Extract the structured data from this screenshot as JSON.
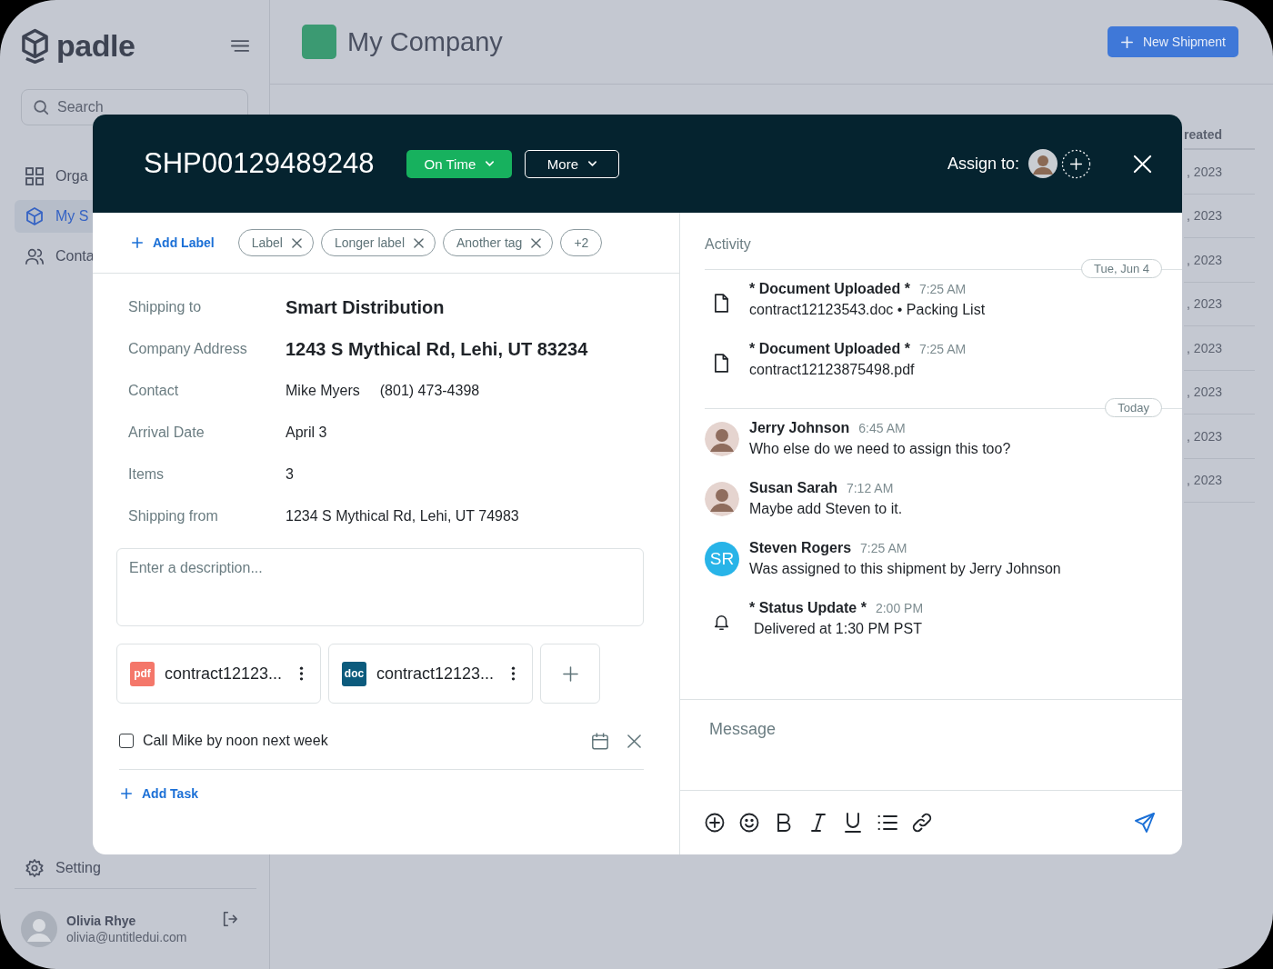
{
  "app": {
    "logo": "padle",
    "company": "My Company",
    "new_button": "New Shipment"
  },
  "sidebar": {
    "search_placeholder": "Search",
    "items": [
      {
        "label": "Orga",
        "selected": false
      },
      {
        "label": "My S",
        "selected": true
      },
      {
        "label": "Conta",
        "selected": false
      }
    ],
    "settings": "Setting",
    "user": {
      "name": "Olivia Rhye",
      "email": "olivia@untitledui.com"
    }
  },
  "table": {
    "column_header": "reated",
    "rows": [
      ", 2023",
      ", 2023",
      ", 2023",
      ", 2023",
      ", 2023",
      ", 2023",
      ", 2023",
      ", 2023"
    ]
  },
  "modal": {
    "title": "SHP00129489248",
    "status": "On Time",
    "more": "More",
    "assign_label": "Assign to:",
    "add_label": "Add Label",
    "labels": [
      "Label",
      "Longer label",
      "Another tag"
    ],
    "labels_more": "+2",
    "details": [
      {
        "label": "Shipping to",
        "values": [
          "Smart Distribution"
        ],
        "emphasis": true
      },
      {
        "label": "Company Address",
        "values": [
          "1243 S Mythical Rd, Lehi, UT 83234"
        ],
        "emphasis": true
      },
      {
        "label": "Contact",
        "values": [
          "Mike Myers",
          "(801) 473-4398"
        ],
        "emphasis": false
      },
      {
        "label": "Arrival Date",
        "values": [
          "April 3"
        ],
        "emphasis": false
      },
      {
        "label": "Items",
        "values": [
          "3"
        ],
        "emphasis": false
      },
      {
        "label": "Shipping from",
        "values": [
          "1234 S Mythical Rd, Lehi, UT 74983"
        ],
        "emphasis": false
      }
    ],
    "description_placeholder": "Enter a description...",
    "attachments": [
      {
        "type": "pdf",
        "name": "contract12123...",
        "color": "#f4776a"
      },
      {
        "type": "doc",
        "name": "contract12123...",
        "color": "#0c5b7d"
      }
    ],
    "tasks": [
      {
        "text": "Call Mike by noon next week",
        "checked": false
      }
    ],
    "add_task": "Add Task",
    "activity_title": "Activity",
    "activity": [
      {
        "kind": "divider",
        "label": "Tue, Jun 4"
      },
      {
        "kind": "document",
        "title": "* Document Uploaded *",
        "time": "7:25 AM",
        "text": "contract12123543.doc • Packing List"
      },
      {
        "kind": "document",
        "title": "* Document Uploaded *",
        "time": "7:25 AM",
        "text": "contract12123875498.pdf"
      },
      {
        "kind": "divider",
        "label": "Today"
      },
      {
        "kind": "comment",
        "title": "Jerry Johnson",
        "time": "6:45 AM",
        "text": "Who else do we need to assign this too?"
      },
      {
        "kind": "comment",
        "title": "Susan Sarah",
        "time": "7:12 AM",
        "text": "Maybe add Steven to it."
      },
      {
        "kind": "comment",
        "initials": "SR",
        "title": "Steven Rogers",
        "time": "7:25 AM",
        "text": "Was assigned to this shipment by Jerry Johnson"
      },
      {
        "kind": "status",
        "title": "* Status Update *",
        "time": "2:00 PM",
        "text": "Delivered at 1:30 PM PST"
      }
    ],
    "message_placeholder": "Message"
  }
}
